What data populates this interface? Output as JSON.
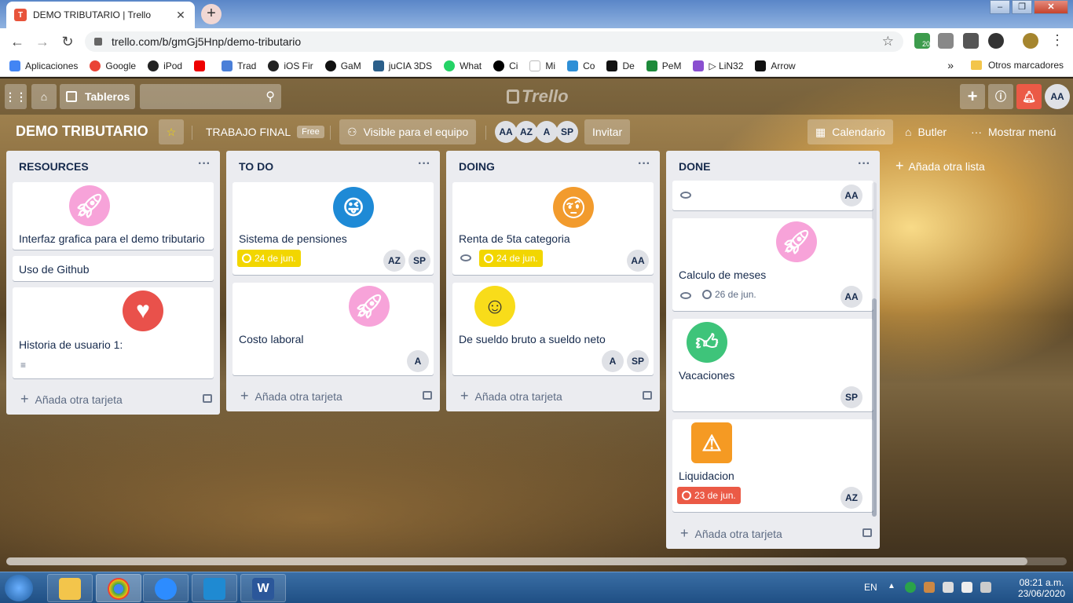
{
  "browser": {
    "tab_title": "DEMO TRIBUTARIO | Trello",
    "url": "trello.com/b/gmGj5Hnp/demo-tributario",
    "ext_badge": "20",
    "bookmarks": [
      "Aplicaciones",
      "Google",
      "iPod",
      "",
      "Trad",
      "iOS Fir",
      "GaM",
      "juCIA 3DS",
      "What",
      "Ci",
      "Mi",
      "Co",
      "De",
      "PeM",
      "▷ LiN32",
      "Arrow"
    ],
    "bookmark_more": "»",
    "other_bookmarks": "Otros marcadores"
  },
  "header": {
    "boards_label": "Tableros",
    "logo": "Trello",
    "user_initials": "AA"
  },
  "board": {
    "title": "DEMO TRIBUTARIO",
    "team": "TRABAJO FINAL",
    "plan": "Free",
    "visibility": "Visible para el equipo",
    "members": [
      "AA",
      "AZ",
      "A",
      "SP"
    ],
    "invite": "Invitar",
    "calendar": "Calendario",
    "butler": "Butler",
    "show_menu": "Mostrar menú",
    "add_list": "Añada otra lista"
  },
  "lists": [
    {
      "title": "RESOURCES",
      "add_card": "Añada otra tarjeta",
      "cards": [
        {
          "title": "Interfaz grafica para el demo tributario",
          "sticker": "rocket-sticker"
        },
        {
          "title": "Uso de Github"
        },
        {
          "title": "Historia de usuario 1:",
          "sticker": "heart-sticker"
        }
      ]
    },
    {
      "title": "TO DO",
      "add_card": "Añada otra tarjeta",
      "cards": [
        {
          "title": "Sistema de pensiones",
          "sticker": "wink-face-sticker",
          "due": "24 de jun.",
          "members": [
            "AZ",
            "SP"
          ]
        },
        {
          "title": "Costo laboral",
          "sticker": "rocket-sticker",
          "members": [
            "A"
          ]
        }
      ]
    },
    {
      "title": "DOING",
      "add_card": "Añada otra tarjeta",
      "cards": [
        {
          "title": "Renta de 5ta categoria",
          "sticker": "thinking-face-sticker",
          "due": "24 de jun.",
          "members": [
            "AA"
          ]
        },
        {
          "title": "De sueldo bruto a sueldo neto",
          "sticker": "smile-face-sticker",
          "members": [
            "A",
            "SP"
          ]
        }
      ]
    },
    {
      "title": "DONE",
      "add_card": "Añada otra tarjeta",
      "cards": [
        {
          "title": "",
          "members": [
            "AA"
          ]
        },
        {
          "title": "Calculo de meses",
          "sticker": "rocket-sticker",
          "date": "26 de jun.",
          "members": [
            "AA"
          ]
        },
        {
          "title": "Vacaciones",
          "sticker": "thumbs-up-sticker",
          "members": [
            "SP"
          ]
        },
        {
          "title": "Liquidacion",
          "sticker": "warning-sticker",
          "due": "23 de jun.",
          "members": [
            "AZ"
          ]
        }
      ]
    }
  ],
  "colors": {
    "due_yellow": "#f2d600",
    "due_red": "#eb5a46",
    "list_bg": "#ebecf0",
    "notify": "#eb5a46"
  },
  "taskbar": {
    "lang": "EN",
    "time": "08:21 a.m.",
    "date": "23/06/2020"
  }
}
